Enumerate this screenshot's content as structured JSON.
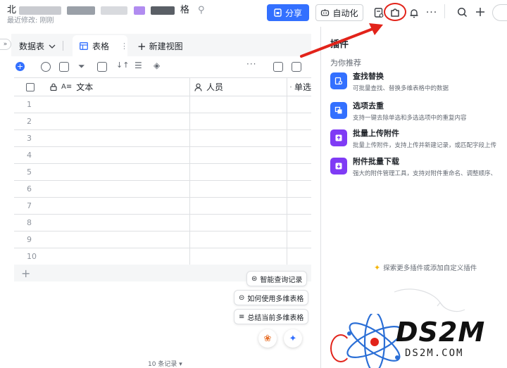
{
  "header": {
    "title_visible_parts": [
      "北",
      "格",
      "⚲"
    ],
    "subtitle": "最近修改: 刚刚",
    "share_label": "分享",
    "automation_label": "自动化"
  },
  "tabs": {
    "datasheet_label": "数据表",
    "table_tab_label": "表格",
    "new_view_label": "新建视图",
    "collapse_glyph": "»"
  },
  "grid": {
    "columns": [
      "文本",
      "人员",
      "单选"
    ],
    "row_numbers": [
      "1",
      "2",
      "3",
      "4",
      "5",
      "6",
      "7",
      "8",
      "9",
      "10"
    ],
    "add_row_glyph": "+",
    "record_count": "10 条记录"
  },
  "assistant": {
    "chips": [
      "智能查询记录",
      "如何使用多维表格",
      "总结当前多维表格"
    ]
  },
  "plugin_panel": {
    "title": "插件",
    "section_title": "为你推荐",
    "plugins": [
      {
        "name": "查找替换",
        "desc": "可批量查找、替换多维表格中的数据",
        "color": "#3370ff",
        "icon": "find-replace-icon"
      },
      {
        "name": "选项去重",
        "desc": "支持一键去除单选和多选选项中的重复内容",
        "color": "#3370ff",
        "icon": "dedupe-icon"
      },
      {
        "name": "批量上传附件",
        "desc": "批量上传附件，支持上传并新建记录，或匹配字段上传",
        "color": "#7f3bf5",
        "icon": "upload-icon"
      },
      {
        "name": "附件批量下载",
        "desc": "强大的附件管理工具，支持对附件重命名、调整顺序、",
        "color": "#7f3bf5",
        "icon": "download-icon"
      }
    ],
    "explore_text": "探索更多插件或添加自定义插件"
  },
  "watermark": {
    "text": "DS2M",
    "url": "DS2M.COM"
  },
  "colors": {
    "primary": "#3370ff",
    "annotation_red": "#e2231a",
    "purple": "#7f3bf5"
  }
}
